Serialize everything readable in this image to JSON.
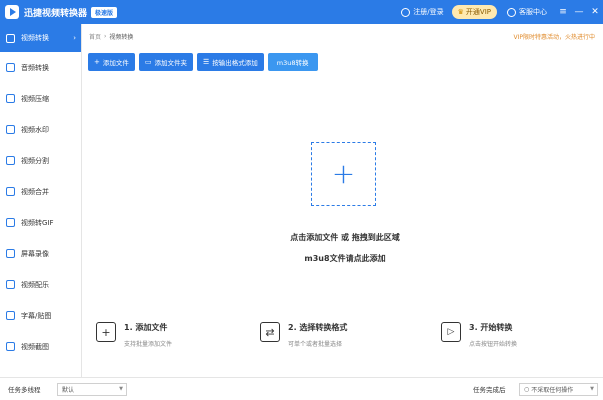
{
  "titlebar": {
    "app_title": "迅捷视频转换器",
    "edition": "极速版",
    "login": "注册/登录",
    "vip": "开通VIP",
    "service": "客服中心"
  },
  "sidebar": {
    "items": [
      {
        "label": "视频转换",
        "active": true
      },
      {
        "label": "音频转换"
      },
      {
        "label": "视频压缩"
      },
      {
        "label": "视频水印"
      },
      {
        "label": "视频分割"
      },
      {
        "label": "视频合并"
      },
      {
        "label": "视频转GIF"
      },
      {
        "label": "屏幕录像"
      },
      {
        "label": "视频配乐"
      },
      {
        "label": "字幕/贴图"
      },
      {
        "label": "视频截图"
      }
    ]
  },
  "breadcrumb": {
    "home": "首页",
    "sep": "›",
    "current": "视频转换"
  },
  "promo": "VIP限时特惠活动，火热进行中",
  "toolbar": {
    "add_file": "添加文件",
    "add_folder": "添加文件夹",
    "batch_add": "按输出格式添加",
    "m3u8": "m3u8转换"
  },
  "dropzone": {
    "line1": "点击添加文件 或 拖拽到此区域",
    "line2": "m3u8文件请点此添加"
  },
  "steps": [
    {
      "title": "1. 添加文件",
      "desc": "支持批量添加文件"
    },
    {
      "title": "2. 选择转换格式",
      "desc": "可单个或者批量选择"
    },
    {
      "title": "3. 开始转换",
      "desc": "点击按钮开始转换"
    }
  ],
  "footer": {
    "threads_label": "任务多线程",
    "threads_value": "默认",
    "after_label": "任务完成后",
    "after_value": "不采取任何操作"
  },
  "colors": {
    "accent": "#2b7be6",
    "promo": "#e08a2a"
  }
}
